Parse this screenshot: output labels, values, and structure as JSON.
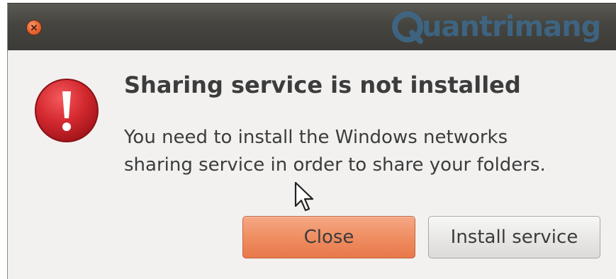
{
  "watermark": {
    "text": "uantrimang",
    "color": "#3d6a8c"
  },
  "titlebar": {
    "close_icon": "close-x-icon",
    "close_color": "#ec6a35"
  },
  "dialog": {
    "icon": "error-exclamation-icon",
    "icon_color": "#c8202a",
    "title": "Sharing service is not installed",
    "message_line1": "You need to install the Windows networks",
    "message_line2": "sharing service in order to share your folders.",
    "buttons": {
      "close_label": "Close",
      "install_label": "Install service"
    },
    "accent_color": "#ef8e62"
  },
  "pointer": {
    "icon": "mouse-pointer-icon"
  }
}
